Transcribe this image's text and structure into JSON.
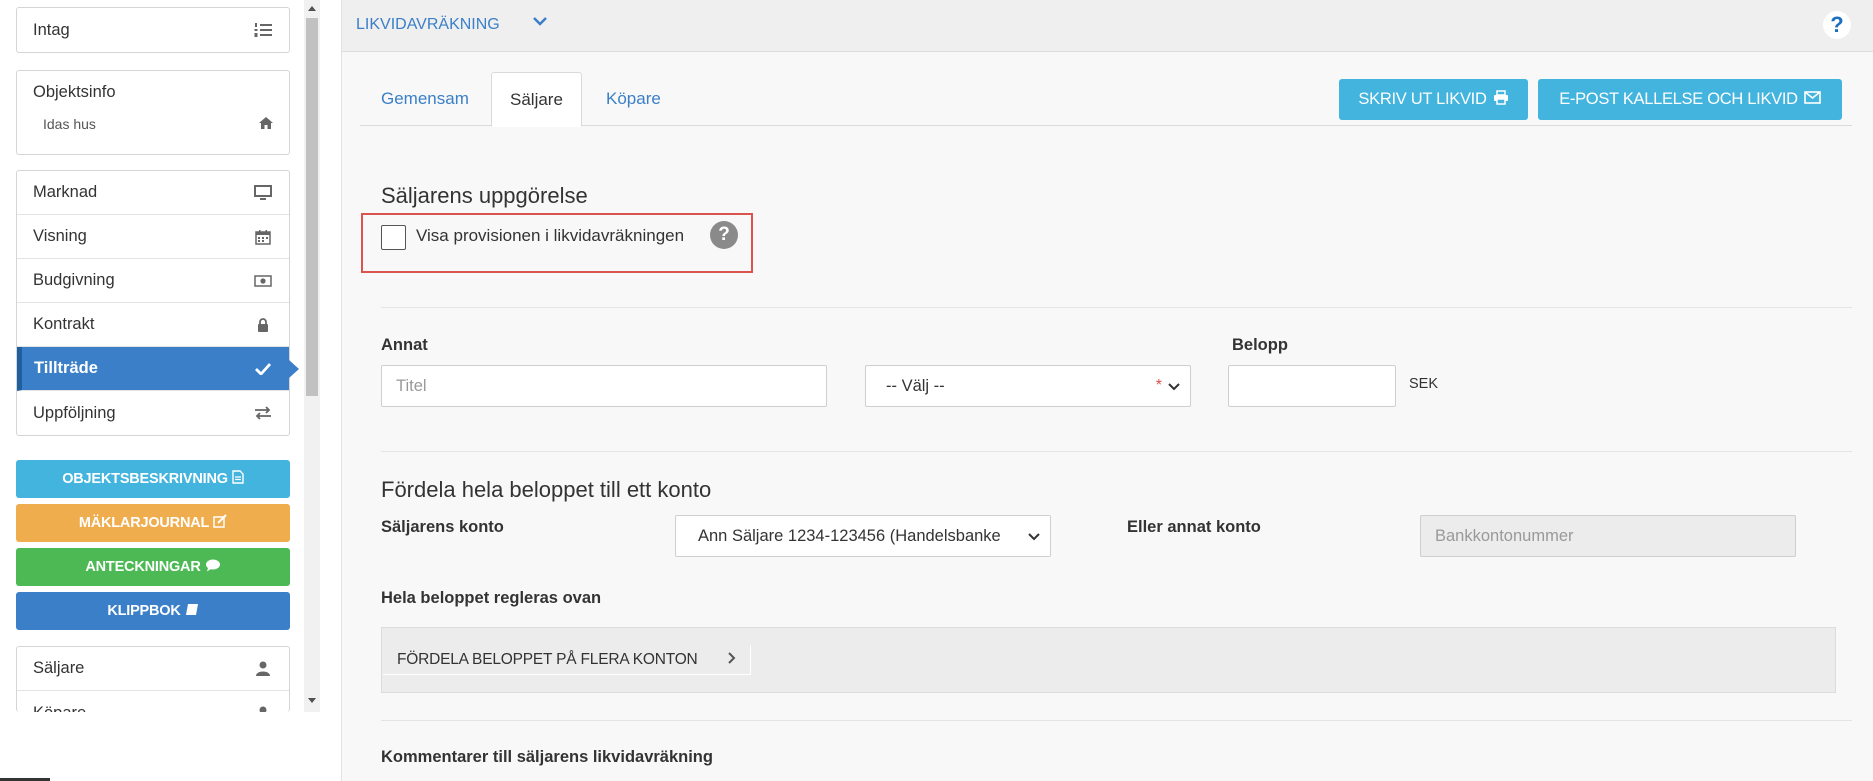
{
  "sidebar": {
    "intag": "Intag",
    "objektsinfo": {
      "title": "Objektsinfo",
      "sub": "Idas hus"
    },
    "nav": [
      {
        "label": "Marknad",
        "icon": "monitor-icon"
      },
      {
        "label": "Visning",
        "icon": "calendar-icon"
      },
      {
        "label": "Budgivning",
        "icon": "money-icon"
      },
      {
        "label": "Kontrakt",
        "icon": "lock-icon"
      },
      {
        "label": "Tillträde",
        "icon": "check-icon",
        "active": true
      },
      {
        "label": "Uppföljning",
        "icon": "exchange-icon"
      }
    ],
    "actions": [
      {
        "label": "OBJEKTSBESKRIVNING",
        "color": "#42b4de",
        "icon": "file-text-icon"
      },
      {
        "label": "MÄKLARJOURNAL",
        "color": "#f0ad4e",
        "icon": "edit-icon"
      },
      {
        "label": "ANTECKNINGAR",
        "color": "#4cb954",
        "icon": "comment-icon"
      },
      {
        "label": "KLIPPBOK",
        "color": "#3a7fc8",
        "icon": "book-icon"
      }
    ],
    "people": [
      {
        "label": "Säljare",
        "icon": "user-icon"
      },
      {
        "label": "Köpare",
        "icon": "user-icon"
      }
    ]
  },
  "header": {
    "title": "LIKVIDAVRÄKNING",
    "help": "?"
  },
  "tabs": [
    {
      "label": "Gemensam"
    },
    {
      "label": "Säljare",
      "active": true
    },
    {
      "label": "Köpare"
    }
  ],
  "toolbar": {
    "print_label": "SKRIV UT LIKVID",
    "email_label": "E-POST KALLELSE OCH LIKVID"
  },
  "seller": {
    "heading": "Säljarens uppgörelse",
    "show_commission_label": "Visa provisionen i likvidavräkningen",
    "show_commission_checked": false,
    "help": "?"
  },
  "other": {
    "label": "Annat",
    "title_placeholder": "Titel",
    "select_value": "-- Välj --",
    "required_star": "*",
    "amount_label": "Belopp",
    "currency": "SEK"
  },
  "distribute": {
    "heading": "Fördela hela beloppet till ett konto",
    "seller_account_label": "Säljarens konto",
    "seller_account_value": "Ann Säljare 1234-123456 (Handelsbanke",
    "other_account_label": "Eller annat konto",
    "other_account_placeholder": "Bankkontonummer",
    "settled_text": "Hela beloppet regleras ovan",
    "multi_button": "FÖRDELA BELOPPET PÅ FLERA KONTON"
  },
  "comments": {
    "label": "Kommentarer till säljarens likvidavräkning"
  }
}
